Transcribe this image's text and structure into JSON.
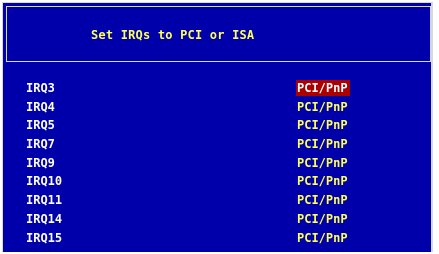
{
  "title": "Set IRQs to PCI or ISA",
  "colors": {
    "background": "#0000aa",
    "label": "#ffffff",
    "value": "#ffff55",
    "selected_bg": "#aa0000",
    "border": "#d8d8d8"
  },
  "irqs": [
    {
      "label": "IRQ3",
      "value": "PCI/PnP",
      "selected": true
    },
    {
      "label": "IRQ4",
      "value": "PCI/PnP",
      "selected": false
    },
    {
      "label": "IRQ5",
      "value": "PCI/PnP",
      "selected": false
    },
    {
      "label": "IRQ7",
      "value": "PCI/PnP",
      "selected": false
    },
    {
      "label": "IRQ9",
      "value": "PCI/PnP",
      "selected": false
    },
    {
      "label": "IRQ10",
      "value": "PCI/PnP",
      "selected": false
    },
    {
      "label": "IRQ11",
      "value": "PCI/PnP",
      "selected": false
    },
    {
      "label": "IRQ14",
      "value": "PCI/PnP",
      "selected": false
    },
    {
      "label": "IRQ15",
      "value": "PCI/PnP",
      "selected": false
    }
  ]
}
